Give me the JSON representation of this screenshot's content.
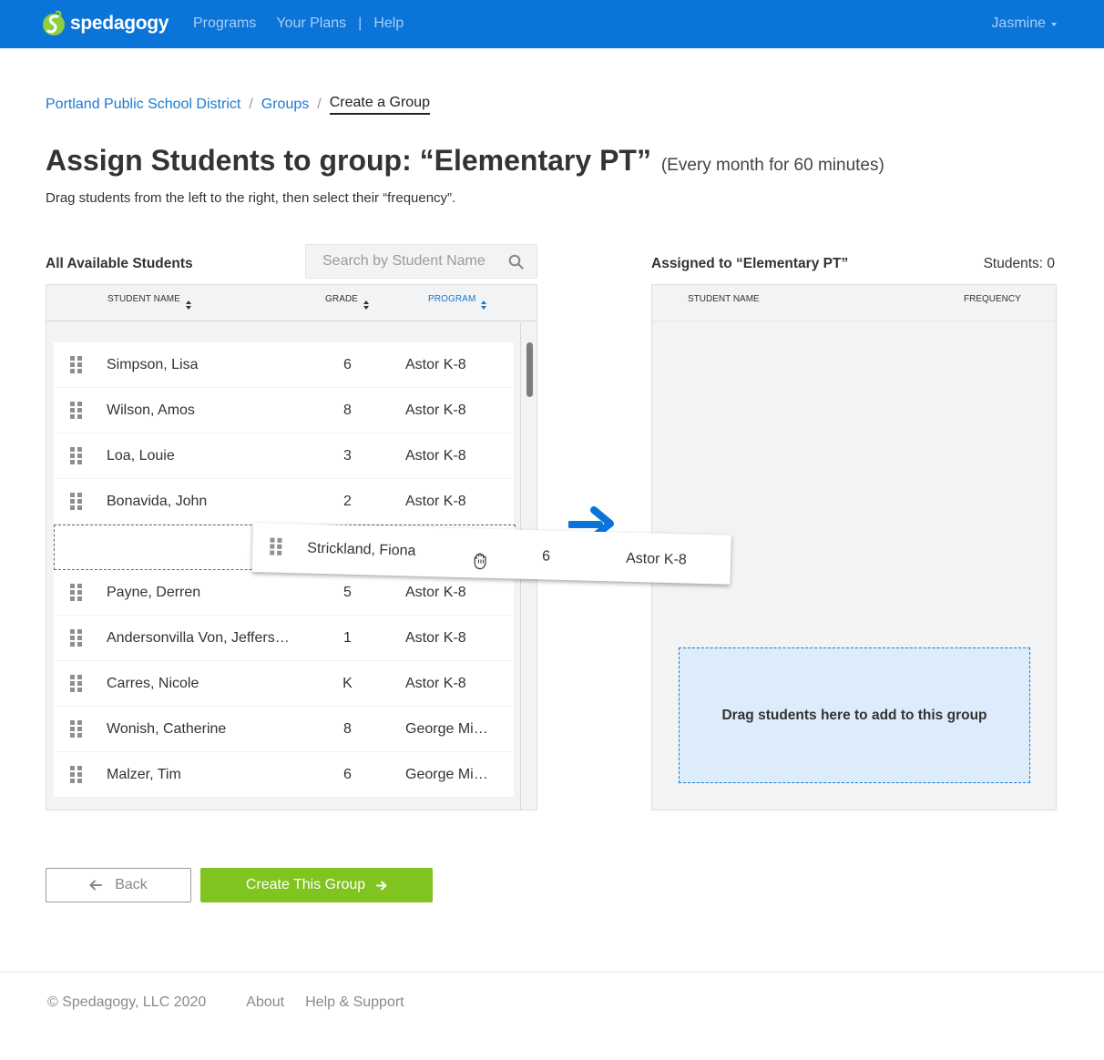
{
  "brand": {
    "name": "spedagogy",
    "color": "#0a74d9"
  },
  "nav": {
    "programs": "Programs",
    "your_plans": "Your Plans",
    "separator": "|",
    "help": "Help",
    "user_name": "Jasmine"
  },
  "breadcrumb": {
    "items": [
      "Portland Public School District",
      "Groups",
      "Create a Group"
    ],
    "separator": "/"
  },
  "heading": {
    "title": "Assign Students to group: “Elementary PT”",
    "subtitle": "(Every month for 60 minutes)",
    "instructions": "Drag students from the left to the right, then select their “frequency”."
  },
  "available": {
    "title": "All Available Students",
    "search_placeholder": "Search by Student Name",
    "columns": {
      "name": "STUDENT NAME",
      "grade": "GRADE",
      "program": "PROGRAM"
    },
    "rows": [
      {
        "name": "Simpson, Lisa",
        "grade": "6",
        "program": "Astor K-8"
      },
      {
        "name": "Wilson, Amos",
        "grade": "8",
        "program": "Astor K-8"
      },
      {
        "name": "Loa, Louie",
        "grade": "3",
        "program": "Astor K-8"
      },
      {
        "name": "Bonavida, John",
        "grade": "2",
        "program": "Astor K-8"
      },
      {
        "name": "Payne, Derren",
        "grade": "5",
        "program": "Astor K-8"
      },
      {
        "name": "Andersonvilla Von, Jeffers…",
        "grade": "1",
        "program": "Astor K-8"
      },
      {
        "name": "Carres, Nicole",
        "grade": "K",
        "program": "Astor K-8"
      },
      {
        "name": "Wonish, Catherine",
        "grade": "8",
        "program": "George Mi…"
      },
      {
        "name": "Malzer, Tim",
        "grade": "6",
        "program": "George Mi…"
      }
    ],
    "dragging": {
      "name": "Strickland, Fiona",
      "grade": "6",
      "program": "Astor K-8"
    }
  },
  "assigned": {
    "title": "Assigned to “Elementary PT”",
    "count_label": "Students: 0",
    "columns": {
      "name": "STUDENT NAME",
      "frequency": "FREQUENCY"
    },
    "drop_hint": "Drag students here to add to this group"
  },
  "actions": {
    "back": "Back",
    "create": "Create This Group"
  },
  "footer": {
    "copyright": "© Spedagogy, LLC 2020",
    "about": "About",
    "help_support": "Help & Support"
  },
  "colors": {
    "accent_blue": "#1a7ad2",
    "create_green": "#7fc41f",
    "drop_zone": "#dcecfb"
  }
}
